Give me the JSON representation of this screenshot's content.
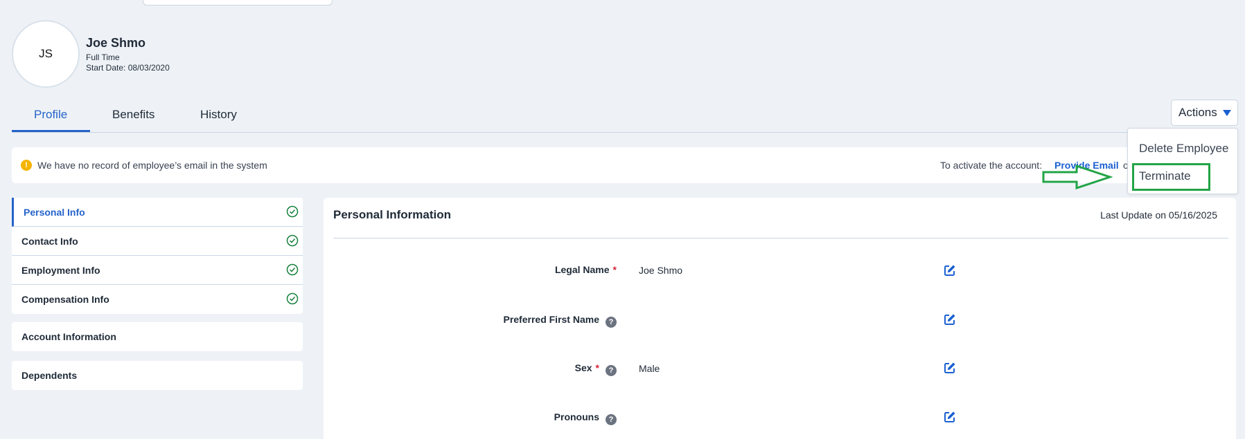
{
  "employee": {
    "initials": "JS",
    "name": "Joe Shmo",
    "employment_type": "Full Time",
    "start_date": "Start Date: 08/03/2020"
  },
  "tabs": [
    {
      "label": "Profile",
      "active": true
    },
    {
      "label": "Benefits",
      "active": false
    },
    {
      "label": "History",
      "active": false
    }
  ],
  "actions": {
    "label": "Actions",
    "menu": [
      "Delete Employee",
      "Terminate"
    ]
  },
  "banner": {
    "message": "We have no record of employee’s email in the system",
    "activate_text": "To activate the account:",
    "link": "Provide Email",
    "tail": "o"
  },
  "sidebar": {
    "group1": [
      {
        "label": "Personal Info",
        "active": true,
        "complete": true
      },
      {
        "label": "Contact Info",
        "active": false,
        "complete": true
      },
      {
        "label": "Employment Info",
        "active": false,
        "complete": true
      },
      {
        "label": "Compensation Info",
        "active": false,
        "complete": true
      }
    ],
    "account": "Account Information",
    "dependents": "Dependents"
  },
  "panel": {
    "title": "Personal Information",
    "last_update": "Last Update on 05/16/2025",
    "fields": [
      {
        "label": "Legal Name",
        "required": true,
        "help": false,
        "value": "Joe Shmo"
      },
      {
        "label": "Preferred First Name",
        "required": false,
        "help": true,
        "value": ""
      },
      {
        "label": "Sex",
        "required": true,
        "help": true,
        "value": "Male"
      },
      {
        "label": "Pronouns",
        "required": false,
        "help": true,
        "value": ""
      }
    ]
  },
  "colors": {
    "accent": "#2563c9",
    "highlight": "#22a447",
    "warning": "#f5b400",
    "required": "#d6243a"
  }
}
